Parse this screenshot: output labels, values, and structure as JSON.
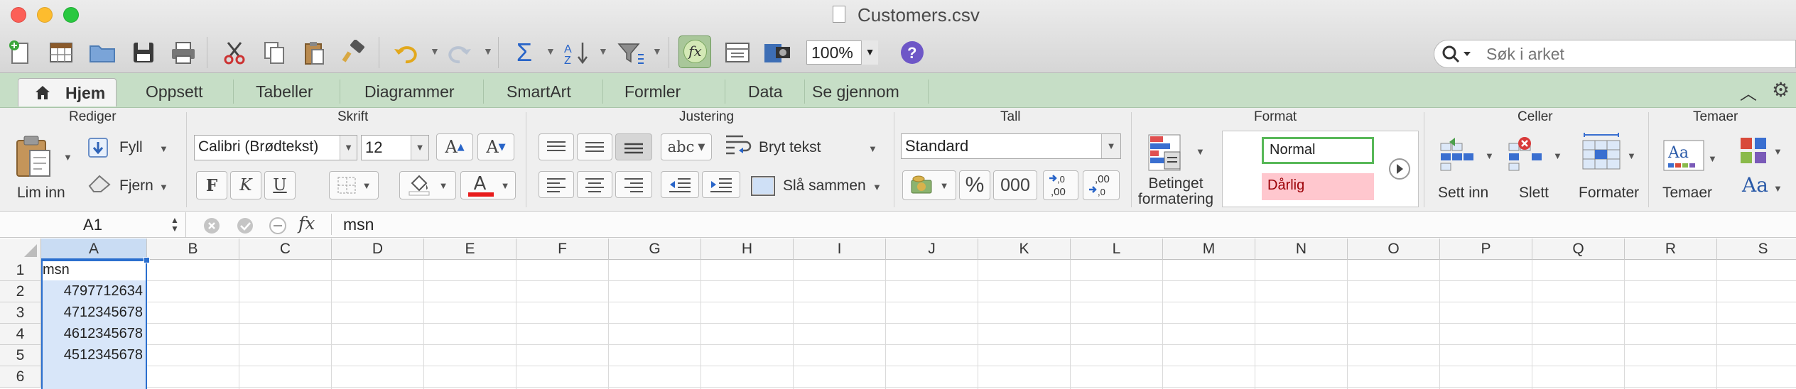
{
  "window": {
    "title": "Customers.csv"
  },
  "toolbar": {
    "zoom": "100%",
    "search_placeholder": "Søk i arket"
  },
  "tabs": [
    "Hjem",
    "Oppsett",
    "Tabeller",
    "Diagrammer",
    "SmartArt",
    "Formler",
    "Data",
    "Se gjennom"
  ],
  "ribbon": {
    "groups": [
      "Rediger",
      "Skrift",
      "Justering",
      "Tall",
      "Format",
      "Celler",
      "Temaer"
    ],
    "paste_label": "Lim inn",
    "fill_label": "Fyll",
    "clear_label": "Fjern",
    "font_name": "Calibri (Brødtekst)",
    "font_size": "12",
    "bold": "F",
    "italic": "K",
    "underline": "U",
    "wrap_text": "Bryt tekst",
    "merge": "Slå sammen",
    "orientation_label": "abc",
    "number_format": "Standard",
    "percent": "%",
    "thousands": "000",
    "inc_decimal": ",00",
    "dec_decimal": ",00",
    "conditional_formatting": [
      "Betinget",
      "formatering"
    ],
    "style_normal": "Normal",
    "style_bad": "Dårlig",
    "insert_label": "Sett inn",
    "delete_label": "Slett",
    "format_label": "Formater",
    "themes_label": "Temaer",
    "themes_font_glyph": "Aa",
    "grow_font": "A",
    "shrink_font": "A",
    "font_color": "A",
    "font_color_value": "#e81c1c"
  },
  "formula_bar": {
    "cell_ref": "A1",
    "fx": "fx",
    "content": "msn"
  },
  "grid": {
    "columns": [
      "A",
      "B",
      "C",
      "D",
      "E",
      "F",
      "G",
      "H",
      "I",
      "J",
      "K",
      "L",
      "M",
      "N",
      "O",
      "P",
      "Q",
      "R",
      "S"
    ],
    "rows": [
      "1",
      "2",
      "3",
      "4",
      "5",
      "6"
    ],
    "cells": [
      {
        "row": 1,
        "value": "msn",
        "align": "left"
      },
      {
        "row": 2,
        "value": "4797712634",
        "align": "right"
      },
      {
        "row": 3,
        "value": "4712345678",
        "align": "right"
      },
      {
        "row": 4,
        "value": "4612345678",
        "align": "right"
      },
      {
        "row": 5,
        "value": "4512345678",
        "align": "right"
      }
    ],
    "selected_column": "A"
  },
  "colors": {
    "ribbon_tab_bg": "#c6dec6",
    "selection": "#2b6fce",
    "bad_style_bg": "#ffc7ce",
    "bad_style_text": "#9c0006",
    "normal_style_border": "#58b858"
  }
}
